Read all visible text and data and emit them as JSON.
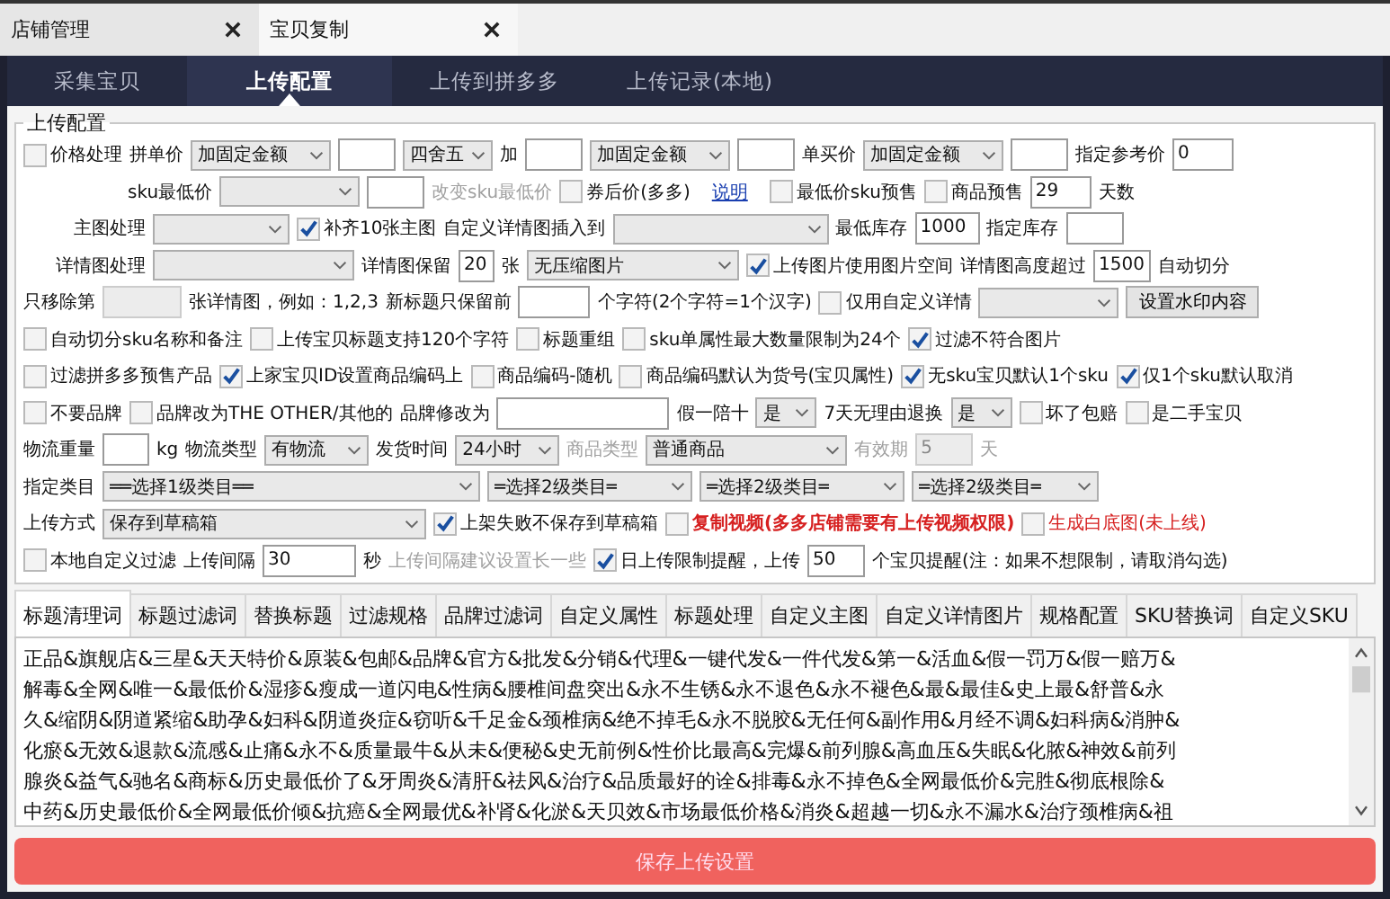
{
  "doc_tabs": [
    {
      "label": "店铺管理",
      "selected": false
    },
    {
      "label": "宝贝复制",
      "selected": true
    }
  ],
  "nav": [
    {
      "label": "采集宝贝",
      "selected": false
    },
    {
      "label": "上传配置",
      "selected": true
    },
    {
      "label": "上传到拼多多",
      "selected": false
    },
    {
      "label": "上传记录(本地)",
      "selected": false
    }
  ],
  "form": {
    "title": "上传配置",
    "rows": [
      {
        "items": [
          {
            "kind": "checkbox",
            "label": "价格处理",
            "checked": false
          },
          {
            "kind": "label",
            "text": "拼单价"
          },
          {
            "kind": "select",
            "value": "加固定金额"
          },
          {
            "kind": "input"
          },
          {
            "kind": "select",
            "value": "四舍五"
          },
          {
            "kind": "label",
            "text": "加"
          },
          {
            "kind": "input"
          },
          {
            "kind": "select",
            "value": "加固定金额"
          },
          {
            "kind": "input"
          },
          {
            "kind": "label",
            "text": "单买价"
          },
          {
            "kind": "select",
            "value": "加固定金额"
          },
          {
            "kind": "input"
          },
          {
            "kind": "label",
            "text": "指定参考价"
          },
          {
            "kind": "input",
            "value": "0"
          }
        ]
      },
      {
        "items": [
          {
            "kind": "label",
            "text": "sku最低价"
          },
          {
            "kind": "select"
          },
          {
            "kind": "input"
          },
          {
            "kind": "label",
            "text": "改变sku最低价",
            "disabled": true
          },
          {
            "kind": "checkbox",
            "label": "券后价(多多)",
            "checked": false
          },
          {
            "kind": "link",
            "text": "说明"
          },
          {
            "kind": "checkbox",
            "label": "最低价sku预售",
            "checked": false
          },
          {
            "kind": "checkbox",
            "label": "商品预售",
            "checked": false
          },
          {
            "kind": "input",
            "value": "29"
          },
          {
            "kind": "label",
            "text": "天数"
          }
        ]
      },
      {
        "items": [
          {
            "kind": "label",
            "text": "主图处理"
          },
          {
            "kind": "select"
          },
          {
            "kind": "checkbox",
            "label": "补齐10张主图",
            "checked": true
          },
          {
            "kind": "label",
            "text": "自定义详情图插入到"
          },
          {
            "kind": "select"
          },
          {
            "kind": "label",
            "text": "最低库存"
          },
          {
            "kind": "input",
            "value": "1000"
          },
          {
            "kind": "label",
            "text": "指定库存"
          },
          {
            "kind": "input"
          }
        ]
      },
      {
        "items": [
          {
            "kind": "label",
            "text": "详情图处理"
          },
          {
            "kind": "select"
          },
          {
            "kind": "label",
            "text": "详情图保留"
          },
          {
            "kind": "input",
            "value": "20"
          },
          {
            "kind": "label",
            "text": "张"
          },
          {
            "kind": "select",
            "value": "无压缩图片"
          },
          {
            "kind": "checkbox",
            "label": "上传图片使用图片空间",
            "checked": true
          },
          {
            "kind": "label",
            "text": "详情图高度超过"
          },
          {
            "kind": "input",
            "value": "1500"
          },
          {
            "kind": "label",
            "text": "自动切分"
          }
        ]
      },
      {
        "items": [
          {
            "kind": "label",
            "text": "只移除第"
          },
          {
            "kind": "input",
            "disabled": true
          },
          {
            "kind": "label",
            "text": "张详情图，例如：1,2,3"
          },
          {
            "kind": "label",
            "text": "新标题只保留前"
          },
          {
            "kind": "input"
          },
          {
            "kind": "label",
            "text": "个字符(2个字符=1个汉字)"
          },
          {
            "kind": "checkbox",
            "label": "仅用自定义详情",
            "checked": false
          },
          {
            "kind": "select"
          },
          {
            "kind": "button",
            "text": "设置水印内容"
          }
        ]
      },
      {
        "items": [
          {
            "kind": "checkbox",
            "label": "自动切分sku名称和备注",
            "checked": false
          },
          {
            "kind": "checkbox",
            "label": "上传宝贝标题支持120个字符",
            "checked": false
          },
          {
            "kind": "checkbox",
            "label": "标题重组",
            "checked": false
          },
          {
            "kind": "checkbox",
            "label": "sku单属性最大数量限制为24个",
            "checked": false
          },
          {
            "kind": "checkbox",
            "label": "过滤不符合图片",
            "checked": true
          }
        ]
      },
      {
        "items": [
          {
            "kind": "checkbox",
            "label": "过滤拼多多预售产品",
            "checked": false
          },
          {
            "kind": "checkbox",
            "label": "上家宝贝ID设置商品编码上",
            "checked": true
          },
          {
            "kind": "checkbox",
            "label": "商品编码-随机",
            "checked": false
          },
          {
            "kind": "checkbox",
            "label": "商品编码默认为货号(宝贝属性)",
            "checked": false
          },
          {
            "kind": "checkbox",
            "label": "无sku宝贝默认1个sku",
            "checked": true
          },
          {
            "kind": "checkbox",
            "label": "仅1个sku默认取消",
            "checked": true
          }
        ]
      },
      {
        "items": [
          {
            "kind": "checkbox",
            "label": "不要品牌",
            "checked": false
          },
          {
            "kind": "checkbox",
            "label": "品牌改为THE OTHER/其他的",
            "checked": false
          },
          {
            "kind": "label",
            "text": "品牌修改为"
          },
          {
            "kind": "input"
          },
          {
            "kind": "label",
            "text": "假一陪十"
          },
          {
            "kind": "select",
            "value": "是"
          },
          {
            "kind": "label",
            "text": "7天无理由退换"
          },
          {
            "kind": "select",
            "value": "是"
          },
          {
            "kind": "checkbox",
            "label": "坏了包赔",
            "checked": false
          },
          {
            "kind": "checkbox",
            "label": "是二手宝贝",
            "checked": false
          }
        ]
      },
      {
        "items": [
          {
            "kind": "label",
            "text": "物流重量"
          },
          {
            "kind": "input"
          },
          {
            "kind": "label",
            "text": "kg"
          },
          {
            "kind": "label",
            "text": "物流类型"
          },
          {
            "kind": "select",
            "value": "有物流"
          },
          {
            "kind": "label",
            "text": "发货时间"
          },
          {
            "kind": "select",
            "value": "24小时"
          },
          {
            "kind": "label",
            "text": "商品类型",
            "disabled": true
          },
          {
            "kind": "select",
            "value": "普通商品"
          },
          {
            "kind": "label",
            "text": "有效期",
            "disabled": true
          },
          {
            "kind": "input",
            "value": "5",
            "disabled": true
          },
          {
            "kind": "label",
            "text": "天",
            "disabled": true
          }
        ]
      },
      {
        "items": [
          {
            "kind": "label",
            "text": "指定类目"
          },
          {
            "kind": "select",
            "value": "══选择1级类目══"
          },
          {
            "kind": "select",
            "value": "═选择2级类目═"
          },
          {
            "kind": "select",
            "value": "═选择2级类目═"
          },
          {
            "kind": "select",
            "value": "═选择2级类目═"
          }
        ]
      },
      {
        "items": [
          {
            "kind": "label",
            "text": "上传方式"
          },
          {
            "kind": "select",
            "value": "保存到草稿箱"
          },
          {
            "kind": "checkbox",
            "label": "上架失败不保存到草稿箱",
            "checked": true
          },
          {
            "kind": "checkbox",
            "label": "复制视频(多多店铺需要有上传视频权限)",
            "checked": false,
            "color": "#d62020",
            "bold": true
          },
          {
            "kind": "checkbox",
            "label": "生成白底图(未上线)",
            "checked": false,
            "color": "#d62020"
          }
        ]
      },
      {
        "items": [
          {
            "kind": "checkbox",
            "label": "本地自定义过滤",
            "checked": false
          },
          {
            "kind": "label",
            "text": "上传间隔"
          },
          {
            "kind": "input",
            "value": "30"
          },
          {
            "kind": "label",
            "text": "秒"
          },
          {
            "kind": "label",
            "text": "上传间隔建议设置长一些",
            "disabled": true
          },
          {
            "kind": "checkbox",
            "label": "日上传限制提醒，上传",
            "checked": true
          },
          {
            "kind": "input",
            "value": "50"
          },
          {
            "kind": "label",
            "text": "个宝贝提醒(注：如果不想限制，请取消勾选)"
          }
        ]
      }
    ]
  },
  "word_tabs": [
    {
      "label": "标题清理词",
      "selected": true
    },
    {
      "label": "标题过滤词",
      "selected": false
    },
    {
      "label": "替换标题",
      "selected": false
    },
    {
      "label": "过滤规格",
      "selected": false
    },
    {
      "label": "品牌过滤词",
      "selected": false
    },
    {
      "label": "自定义属性",
      "selected": false
    },
    {
      "label": "标题处理",
      "selected": false
    },
    {
      "label": "自定义主图",
      "selected": false
    },
    {
      "label": "自定义详情图片",
      "selected": false
    },
    {
      "label": "规格配置",
      "selected": false
    },
    {
      "label": "SKU替换词",
      "selected": false
    },
    {
      "label": "自定义SKU",
      "selected": false
    }
  ],
  "word_lines": [
    "正品&旗舰店&三星&天天特价&原装&包邮&品牌&官方&批发&分销&代理&一键代发&一件代发&第一&活血&假一罚万&假一赔万&",
    "解毒&全网&唯一&最低价&湿疹&瘦成一道闪电&性病&腰椎间盘突出&永不生锈&永不退色&永不褪色&最&最佳&史上最&舒普&永",
    "久&缩阴&阴道紧缩&助孕&妇科&阴道炎症&窃听&千足金&颈椎病&绝不掉毛&永不脱胶&无任何&副作用&月经不调&妇科病&消肿&",
    "化瘀&无效&退款&流感&止痛&永不&质量最牛&从未&便秘&史无前例&性价比最高&完爆&前列腺&高血压&失眠&化脓&神效&前列",
    "腺炎&益气&驰名&商标&历史最低价了&牙周炎&清肝&祛风&治疗&品质最好的诠&排毒&永不掉色&全网最低价&完胜&彻底根除&",
    "中药&历史最低价&全网最低价倾&抗癌&全网最优&补肾&化淤&天贝效&市场最低价格&消炎&超越一切&永不漏水&治疗颈椎病&祖"
  ],
  "save_button": "保存上传设置"
}
